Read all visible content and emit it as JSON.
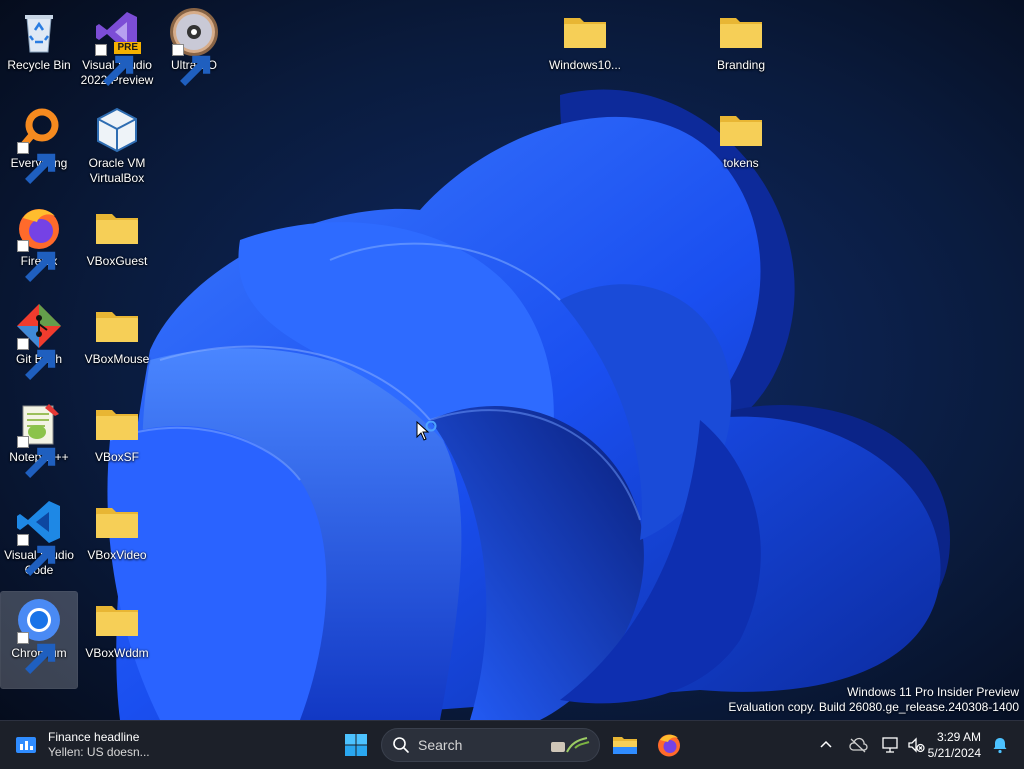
{
  "desktop": {
    "icons": [
      {
        "label": "Recycle Bin",
        "icon": "recycle-bin-icon"
      },
      {
        "label": "Visual Studio 2022 Preview",
        "icon": "visual-studio-icon",
        "badge": "PRE"
      },
      {
        "label": "UltraISO",
        "icon": "ultraiso-disc-icon"
      },
      {
        "label": "Windows10...",
        "icon": "folder-icon"
      },
      {
        "label": "Branding",
        "icon": "folder-icon"
      },
      {
        "label": "Everything",
        "icon": "everything-search-icon"
      },
      {
        "label": "Oracle VM VirtualBox",
        "icon": "virtualbox-icon"
      },
      {
        "label": "tokens",
        "icon": "folder-icon"
      },
      {
        "label": "Firefox",
        "icon": "firefox-icon"
      },
      {
        "label": "VBoxGuest",
        "icon": "folder-icon"
      },
      {
        "label": "Git Bash",
        "icon": "git-bash-icon"
      },
      {
        "label": "VBoxMouse",
        "icon": "folder-icon"
      },
      {
        "label": "Notepad++",
        "icon": "notepad-plus-plus-icon"
      },
      {
        "label": "VBoxSF",
        "icon": "folder-icon"
      },
      {
        "label": "Visual Studio Code",
        "icon": "vscode-icon"
      },
      {
        "label": "VBoxVideo",
        "icon": "folder-icon"
      },
      {
        "label": "Chromium",
        "icon": "chromium-icon"
      },
      {
        "label": "VBoxWddm",
        "icon": "folder-icon"
      }
    ],
    "watermark": {
      "line1": "Windows 11 Pro Insider Preview",
      "line2": "Evaluation copy. Build 26080.ge_release.240308-1400"
    }
  },
  "taskbar": {
    "widget": {
      "title": "Finance headline",
      "subtitle": "Yellen: US doesn..."
    },
    "search_placeholder": "Search",
    "pinned": [
      "start-icon",
      "file-explorer-icon",
      "firefox-icon"
    ],
    "clock": {
      "time": "3:29 AM",
      "date": "5/21/2024"
    }
  },
  "colors": {
    "folder": "#f6cf57",
    "taskbar": "#1c2029",
    "wallpaper_bloom": "#1f54f2"
  }
}
